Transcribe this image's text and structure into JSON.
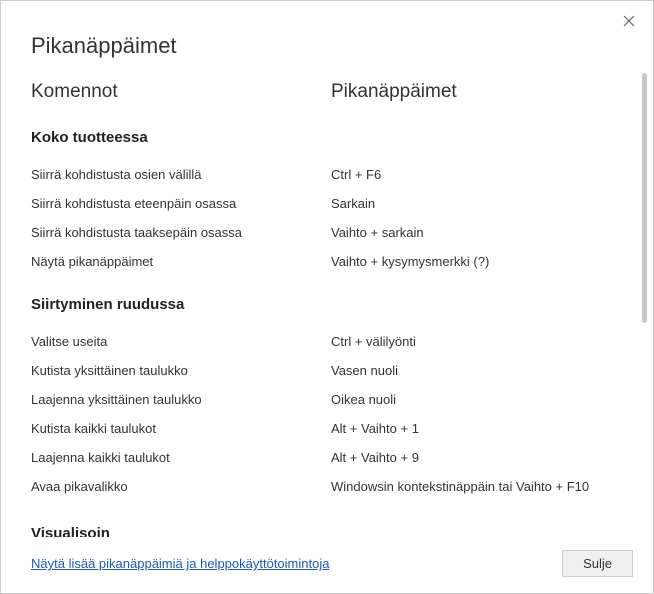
{
  "dialog": {
    "title": "Pikanäppäimet",
    "columns": {
      "commands": "Komennot",
      "shortcuts": "Pikanäppäimet"
    },
    "sections": [
      {
        "heading": "Koko tuotteessa",
        "rows": [
          {
            "command": "Siirrä kohdistusta osien välillä",
            "shortcut": "Ctrl + F6"
          },
          {
            "command": "Siirrä kohdistusta eteenpäin osassa",
            "shortcut": "Sarkain"
          },
          {
            "command": "Siirrä kohdistusta taaksepäin osassa",
            "shortcut": "Vaihto + sarkain"
          },
          {
            "command": "Näytä pikanäppäimet",
            "shortcut": "Vaihto + kysymysmerkki (?)"
          }
        ]
      },
      {
        "heading": "Siirtyminen ruudussa",
        "rows": [
          {
            "command": "Valitse useita",
            "shortcut": "Ctrl + välilyönti"
          },
          {
            "command": "Kutista yksittäinen taulukko",
            "shortcut": "Vasen nuoli"
          },
          {
            "command": "Laajenna yksittäinen taulukko",
            "shortcut": "Oikea nuoli"
          },
          {
            "command": "Kutista kaikki taulukot",
            "shortcut": "Alt + Vaihto + 1"
          },
          {
            "command": "Laajenna kaikki taulukot",
            "shortcut": "Alt + Vaihto + 9"
          },
          {
            "command": "Avaa pikavalikko",
            "shortcut": "Windowsin kontekstinäppäin tai Vaihto + F10"
          }
        ]
      }
    ],
    "partial_heading": "Visualisoin",
    "footer": {
      "link": "Näytä lisää pikanäppäimiä ja helppokäyttötoimintoja",
      "close": "Sulje"
    }
  }
}
